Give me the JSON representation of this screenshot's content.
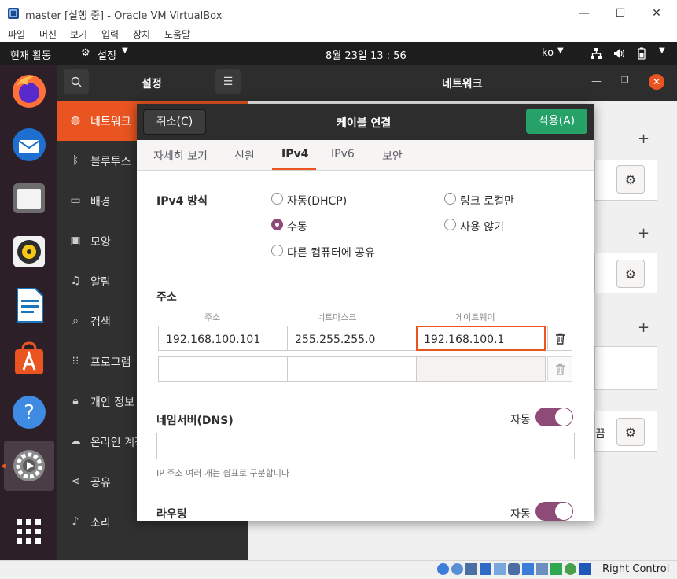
{
  "window": {
    "title": "master [실행 중] - Oracle VM VirtualBox",
    "controls": {
      "minimize": "—",
      "maximize": "☐",
      "close": "✕"
    }
  },
  "vb_menu": [
    "파일",
    "머신",
    "보기",
    "입력",
    "장치",
    "도움말"
  ],
  "topbar": {
    "activities": "현재 활동",
    "app_menu": "설정",
    "clock": "8월 23일  13 : 56",
    "input_lang": "ko"
  },
  "settings": {
    "sidebar_title": "설정",
    "panel_title": "네트워크",
    "items": [
      {
        "label": "네트워크",
        "icon": "globe-icon",
        "active": true
      },
      {
        "label": "블루투스",
        "icon": "bluetooth-icon",
        "active": false
      },
      {
        "label": "배경",
        "icon": "monitor-icon",
        "active": false
      },
      {
        "label": "모양",
        "icon": "appearance-icon",
        "active": false
      },
      {
        "label": "알림",
        "icon": "bell-icon",
        "active": false
      },
      {
        "label": "검색",
        "icon": "search-icon",
        "active": false
      },
      {
        "label": "프로그램",
        "icon": "grid-icon",
        "active": false
      },
      {
        "label": "개인 정보",
        "icon": "lock-icon",
        "active": false
      },
      {
        "label": "온라인 계정",
        "icon": "cloud-icon",
        "active": false
      },
      {
        "label": "공유",
        "icon": "share-icon",
        "active": false
      },
      {
        "label": "소리",
        "icon": "music-icon",
        "active": false
      }
    ],
    "bg_offtext": "끔"
  },
  "dialog": {
    "cancel": "취소(C)",
    "title": "케이블 연결",
    "apply": "적용(A)",
    "tabs": [
      "자세히 보기",
      "신원",
      "IPv4",
      "IPv6",
      "보안"
    ],
    "active_tab": "IPv4",
    "method_label": "IPv4 방식",
    "methods": {
      "dhcp": "자동(DHCP)",
      "link_local": "링크 로컬만",
      "manual": "수동",
      "disabled": "사용 않기",
      "shared": "다른 컴퓨터에 공유"
    },
    "selected_method": "manual",
    "address_section": "주소",
    "columns": [
      "주소",
      "네트마스크",
      "게이트웨이"
    ],
    "rows": [
      {
        "address": "192.168.100.101",
        "netmask": "255.255.255.0",
        "gateway": "192.168.100.1"
      },
      {
        "address": "",
        "netmask": "",
        "gateway": ""
      }
    ],
    "dns_label": "네임서버(DNS)",
    "dns_auto_label": "자동",
    "dns_auto_on": true,
    "dns_value": "",
    "dns_hint": "IP 주소 여러 개는 쉼표로 구분합니다",
    "routing_label": "라우팅",
    "routing_auto_label": "자동",
    "routing_auto_on": true
  },
  "statusbar": {
    "host_key": "Right Control"
  },
  "colors": {
    "accent": "#e95420",
    "apply_green": "#26a269",
    "toggle_on": "#8e4b78",
    "dock_bg": "#2c1f28",
    "topbar_bg": "#1d1d1d"
  }
}
